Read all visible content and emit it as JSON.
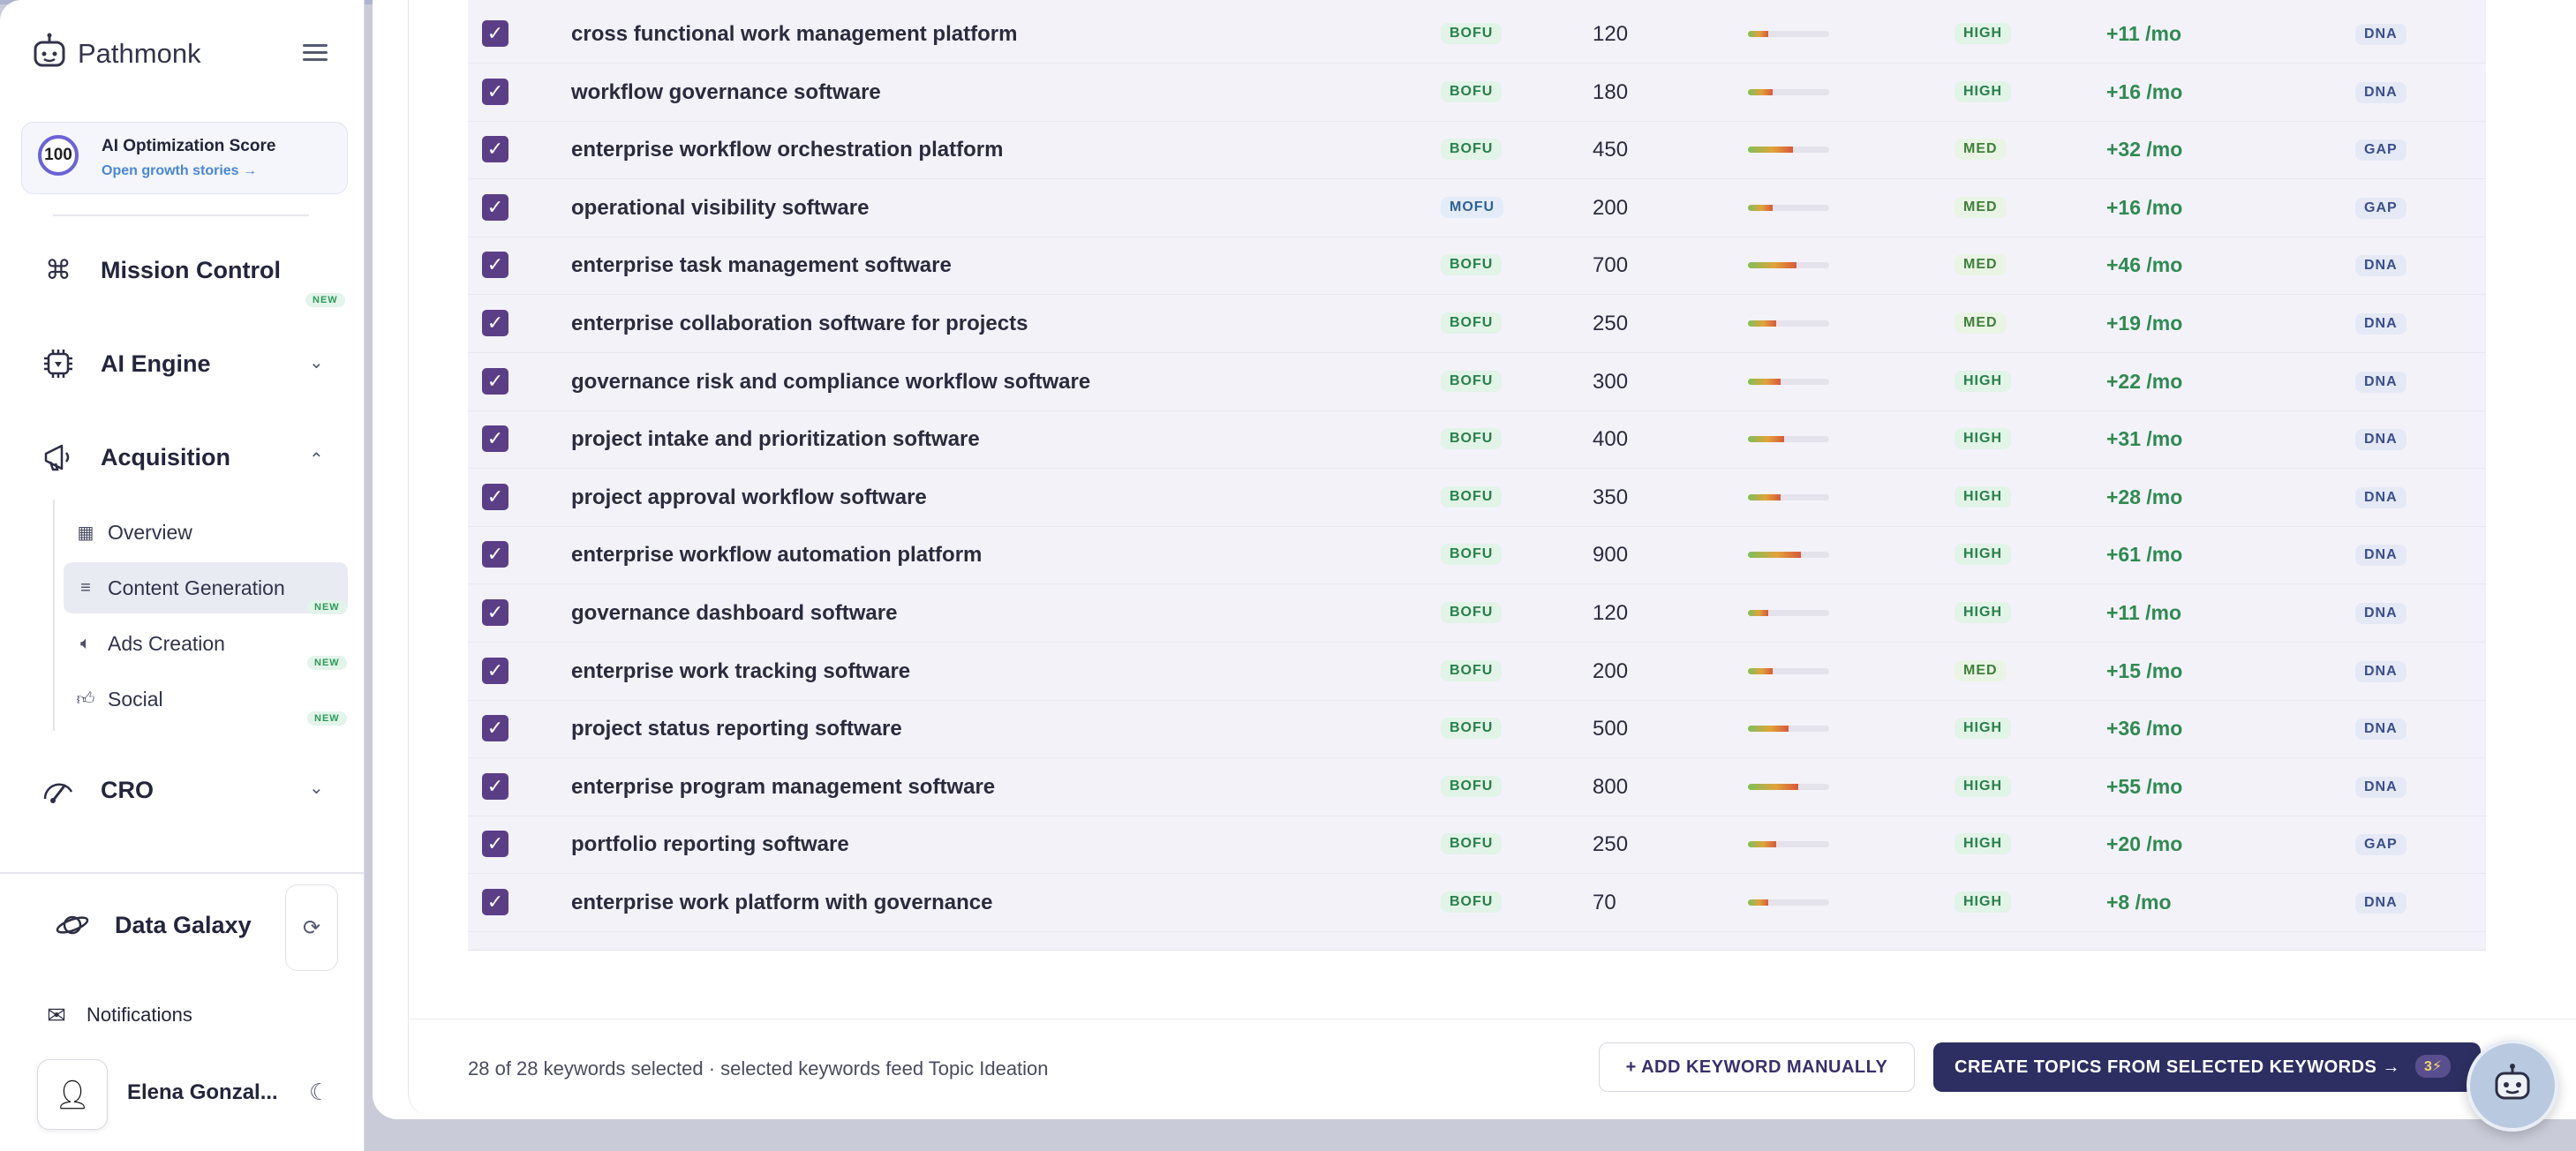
{
  "app": {
    "name": "Pathmonk"
  },
  "sidebar": {
    "score": {
      "value": "100",
      "title": "AI Optimization Score",
      "link": "Open growth stories →"
    },
    "nav": [
      {
        "label": "Mission Control",
        "badge": "NEW"
      },
      {
        "label": "AI Engine"
      },
      {
        "label": "Acquisition"
      },
      {
        "label": "CRO"
      }
    ],
    "sub": [
      {
        "label": "Overview"
      },
      {
        "label": "Content Generation",
        "badge": "NEW"
      },
      {
        "label": "Ads Creation",
        "badge": "NEW"
      },
      {
        "label": "Social",
        "badge": "NEW"
      }
    ],
    "data_galaxy": "Data Galaxy",
    "notifications": "Notifications",
    "user": "Elena Gonzal..."
  },
  "keywords": [
    {
      "keyword": "cross functional work management platform",
      "stage": "BOFU",
      "volume": "120",
      "difficulty": 0.25,
      "priority": "HIGH",
      "traffic": "+11 /mo",
      "source": "DNA"
    },
    {
      "keyword": "workflow governance software",
      "stage": "BOFU",
      "volume": "180",
      "difficulty": 0.3,
      "priority": "HIGH",
      "traffic": "+16 /mo",
      "source": "DNA"
    },
    {
      "keyword": "enterprise workflow orchestration platform",
      "stage": "BOFU",
      "volume": "450",
      "difficulty": 0.55,
      "priority": "MED",
      "traffic": "+32 /mo",
      "source": "GAP"
    },
    {
      "keyword": "operational visibility software",
      "stage": "MOFU",
      "volume": "200",
      "difficulty": 0.3,
      "priority": "MED",
      "traffic": "+16 /mo",
      "source": "GAP"
    },
    {
      "keyword": "enterprise task management software",
      "stage": "BOFU",
      "volume": "700",
      "difficulty": 0.6,
      "priority": "MED",
      "traffic": "+46 /mo",
      "source": "DNA"
    },
    {
      "keyword": "enterprise collaboration software for projects",
      "stage": "BOFU",
      "volume": "250",
      "difficulty": 0.35,
      "priority": "MED",
      "traffic": "+19 /mo",
      "source": "DNA"
    },
    {
      "keyword": "governance risk and compliance workflow software",
      "stage": "BOFU",
      "volume": "300",
      "difficulty": 0.4,
      "priority": "HIGH",
      "traffic": "+22 /mo",
      "source": "DNA"
    },
    {
      "keyword": "project intake and prioritization software",
      "stage": "BOFU",
      "volume": "400",
      "difficulty": 0.45,
      "priority": "HIGH",
      "traffic": "+31 /mo",
      "source": "DNA"
    },
    {
      "keyword": "project approval workflow software",
      "stage": "BOFU",
      "volume": "350",
      "difficulty": 0.4,
      "priority": "HIGH",
      "traffic": "+28 /mo",
      "source": "DNA"
    },
    {
      "keyword": "enterprise workflow automation platform",
      "stage": "BOFU",
      "volume": "900",
      "difficulty": 0.65,
      "priority": "HIGH",
      "traffic": "+61 /mo",
      "source": "DNA"
    },
    {
      "keyword": "governance dashboard software",
      "stage": "BOFU",
      "volume": "120",
      "difficulty": 0.25,
      "priority": "HIGH",
      "traffic": "+11 /mo",
      "source": "DNA"
    },
    {
      "keyword": "enterprise work tracking software",
      "stage": "BOFU",
      "volume": "200",
      "difficulty": 0.3,
      "priority": "MED",
      "traffic": "+15 /mo",
      "source": "DNA"
    },
    {
      "keyword": "project status reporting software",
      "stage": "BOFU",
      "volume": "500",
      "difficulty": 0.5,
      "priority": "HIGH",
      "traffic": "+36 /mo",
      "source": "DNA"
    },
    {
      "keyword": "enterprise program management software",
      "stage": "BOFU",
      "volume": "800",
      "difficulty": 0.62,
      "priority": "HIGH",
      "traffic": "+55 /mo",
      "source": "DNA"
    },
    {
      "keyword": "portfolio reporting software",
      "stage": "BOFU",
      "volume": "250",
      "difficulty": 0.35,
      "priority": "HIGH",
      "traffic": "+20 /mo",
      "source": "GAP"
    },
    {
      "keyword": "enterprise work platform with governance",
      "stage": "BOFU",
      "volume": "70",
      "difficulty": 0.25,
      "priority": "HIGH",
      "traffic": "+8 /mo",
      "source": "DNA"
    }
  ],
  "footer": {
    "status": "28 of 28 keywords selected · selected keywords feed Topic Ideation",
    "add_button": "+ ADD KEYWORD MANUALLY",
    "create_button": "CREATE TOPICS FROM SELECTED KEYWORDS →",
    "credits": "3⚡"
  },
  "colors": {
    "accent": "#2d2f62",
    "checkbox": "#5b3f86",
    "positive": "#2f8a52"
  }
}
